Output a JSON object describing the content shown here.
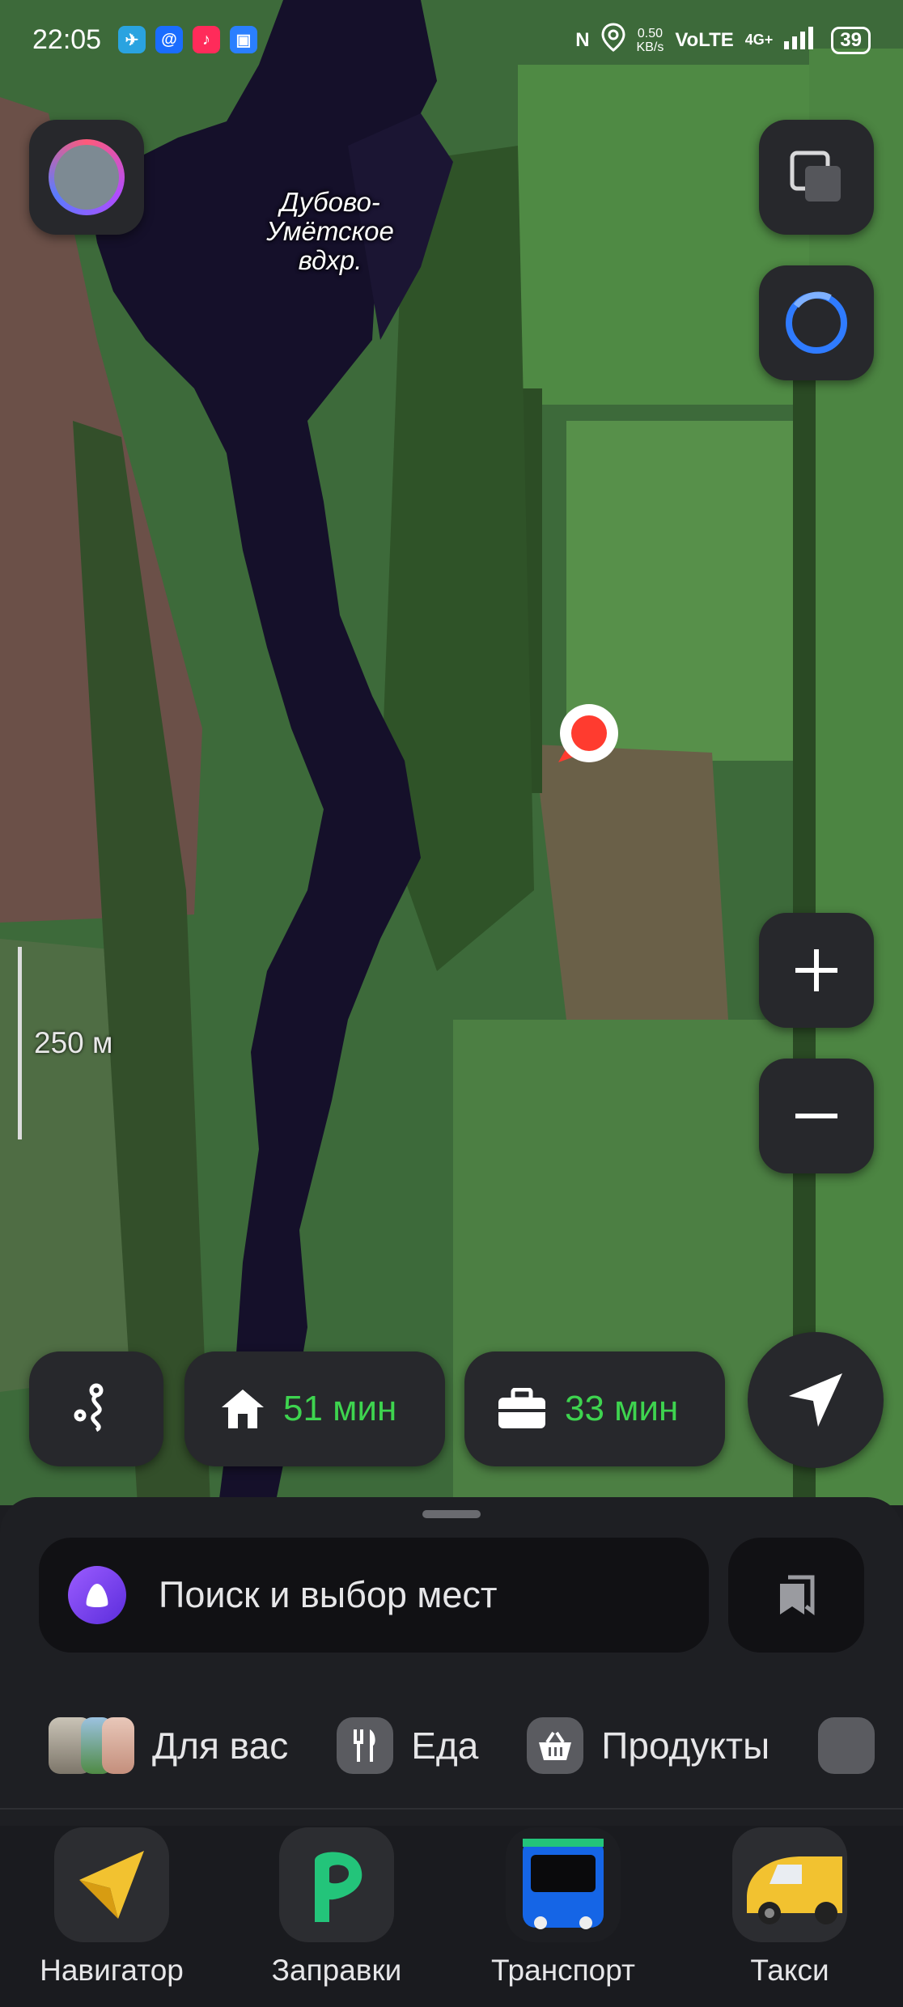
{
  "status_bar": {
    "time": "22:05",
    "speed_value": "0.50",
    "speed_unit": "KB/s",
    "network": "VoLTE",
    "network_gen": "4G+",
    "battery": "39"
  },
  "map": {
    "water_label": "Дубово-\nУмётское\nвдхр.",
    "scale_label": "250 м"
  },
  "quick_routes": {
    "home_time": "51 мин",
    "work_time": "33 мин"
  },
  "search": {
    "placeholder": "Поиск и выбор мест"
  },
  "categories": [
    {
      "label": "Для вас"
    },
    {
      "label": "Еда"
    },
    {
      "label": "Продукты"
    }
  ],
  "services": [
    {
      "label": "Навигатор"
    },
    {
      "label": "Заправки"
    },
    {
      "label": "Транспорт"
    },
    {
      "label": "Такси"
    }
  ],
  "colors": {
    "route_time_green": "#3ed44f",
    "accent_blue": "#2f7bff",
    "pin_red": "#ff3b2f"
  }
}
